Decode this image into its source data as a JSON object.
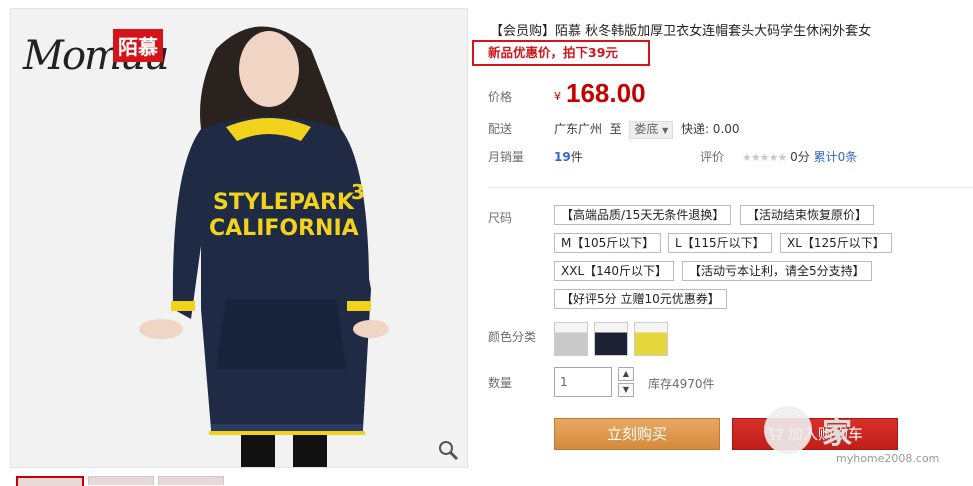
{
  "brand": {
    "script": "Momuu",
    "cn": "陌慕"
  },
  "product": {
    "title": "【会员购】陌慕 秋冬韩版加厚卫衣女连帽套头大码学生休闲外套女",
    "promo": "新品优惠价，拍下39元",
    "price_label": "价格",
    "currency": "¥",
    "price": "168.00",
    "shipping_label": "配送",
    "ship_from": "广东广州",
    "ship_to_word": "至",
    "ship_dest": "娄底",
    "express": "快递: 0.00",
    "sales_label": "月销量",
    "sales_count": "19",
    "sales_unit": "件",
    "rating_label": "评价",
    "rating_stars": "★★★★★",
    "rating_score": "0分",
    "reviews_link": "累计0条"
  },
  "sizes": {
    "label": "尺码",
    "options": [
      "【高端品质/15天无条件退换】",
      "【活动结束恢复原价】",
      "M【105斤以下】",
      "L【115斤以下】",
      "XL【125斤以下】",
      "XXL【140斤以下】",
      "【活动亏本让利，请全5分支持】",
      "【好评5分 立赠10元优惠券】"
    ]
  },
  "colors": {
    "label": "颜色分类",
    "swatch_colors": [
      "#c9c9c9",
      "#1c2233",
      "#e6d73a"
    ]
  },
  "quantity": {
    "label": "数量",
    "value": "1",
    "stock": "库存4970件"
  },
  "actions": {
    "buy_now": "立刻购买",
    "add_to_cart": "加入购物车"
  },
  "watermark": {
    "text": "家",
    "url": "myhome2008.com"
  }
}
